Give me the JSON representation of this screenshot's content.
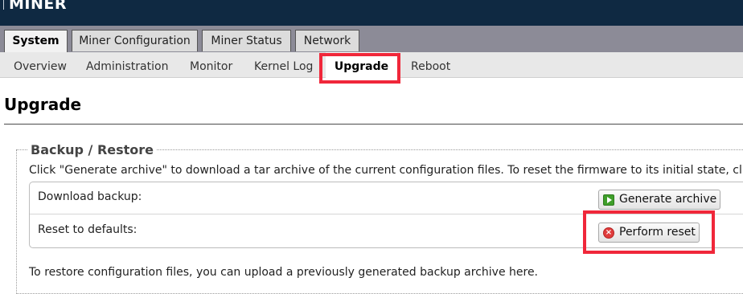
{
  "brand": {
    "name": "MINER"
  },
  "main_tabs": [
    {
      "label": "System",
      "active": true
    },
    {
      "label": "Miner Configuration",
      "active": false
    },
    {
      "label": "Miner Status",
      "active": false
    },
    {
      "label": "Network",
      "active": false
    }
  ],
  "sub_tabs": [
    {
      "label": "Overview",
      "active": false
    },
    {
      "label": "Administration",
      "active": false
    },
    {
      "label": "Monitor",
      "active": false
    },
    {
      "label": "Kernel Log",
      "active": false
    },
    {
      "label": "Upgrade",
      "active": true
    },
    {
      "label": "Reboot",
      "active": false
    }
  ],
  "page": {
    "title": "Upgrade",
    "section": {
      "legend": "Backup / Restore",
      "description": "Click \"Generate archive\" to download a tar archive of the current configuration files. To reset the firmware to its initial state, cli",
      "rows": [
        {
          "label": "Download backup:",
          "button": "Generate archive",
          "icon": "play-icon"
        },
        {
          "label": "Reset to defaults:",
          "button": "Perform reset",
          "icon": "reset-x-icon"
        }
      ],
      "restore_text": "To restore configuration files, you can upload a previously generated backup archive here."
    }
  },
  "colors": {
    "header_bg": "#0f2942",
    "tabbar_bg": "#8c8b97",
    "highlight": "#f0273a"
  }
}
